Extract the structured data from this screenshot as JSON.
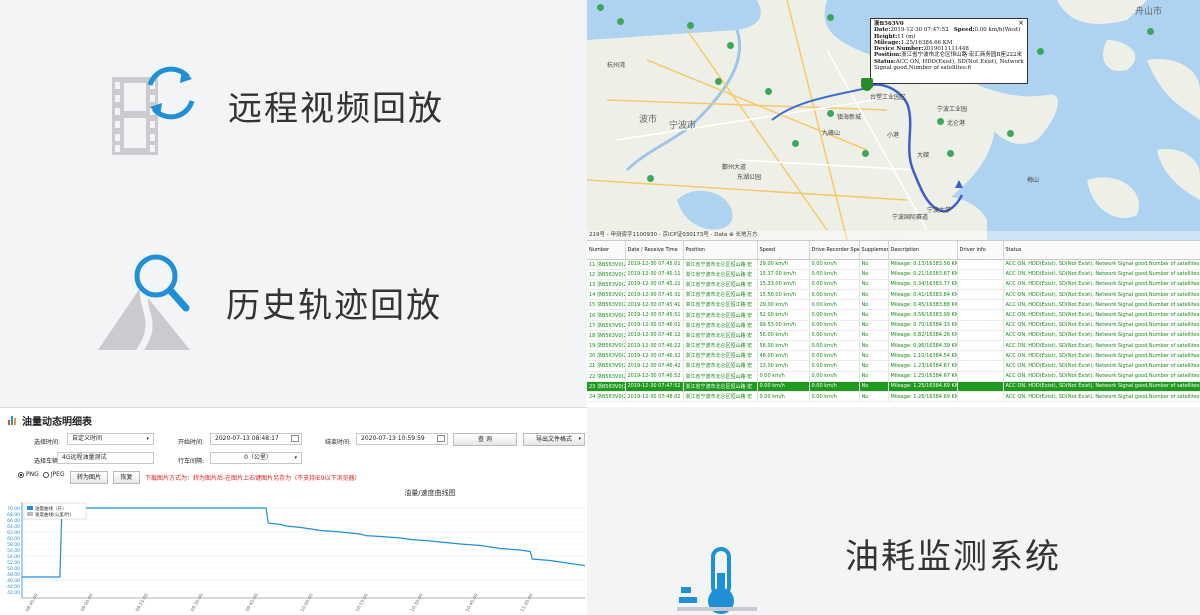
{
  "features": {
    "video": {
      "label": "远程视频回放",
      "icon": "film-sync-icon"
    },
    "track": {
      "label": "历史轨迹回放",
      "icon": "mountain-search-icon"
    },
    "fuel": {
      "label": "油耗监测系统",
      "icon": "thermometer-icon"
    }
  },
  "map": {
    "popup": {
      "plate": "浙B563V0",
      "date_label": "Date:",
      "date": "2019-12-30 07:47:52",
      "speed_label": "Speed:",
      "speed": "0.00 km/h(West)",
      "height_label": "Height:",
      "height": "11 (m)",
      "mileage_label": "Mileage:",
      "mileage": "1.25/16384.66 KM",
      "device_label": "Device Number:",
      "device": "2019011111448",
      "position_label": "Position:",
      "position": "浙江省宁波市北仑区恒山路·宏汇商务园B座222米",
      "status_label": "Status:",
      "status": "ACC ON, HDD(Exist), SD(Not Exist), Network Signal good,Number of satellites:6"
    },
    "cities": [
      "舟山市",
      "宁波市",
      "波市"
    ],
    "labels": [
      "台塑工业园区",
      "宁波工业园",
      "宁波大学",
      "东湖公园",
      "杭州湾",
      "宁波国际赛道",
      "九峰山",
      "镇海新城",
      "鄞州大道",
      "北仑港",
      "梅山",
      "大碶",
      "小港"
    ],
    "footer": "219号 - 甲测资字1100930 - 京ICP证030173号 - Data ⊕ 长地万方"
  },
  "table": {
    "headers": [
      "Number",
      "Date / Receive Time",
      "Position",
      "Speed",
      "Drive Recorder Speed",
      "Supplement",
      "Description",
      "Driver info",
      "Status"
    ],
    "selected_index": 12,
    "rows": [
      [
        "11 浙B563V0(2",
        "2019-12-30 07:45:01",
        "浙江省宁波市北仑区恒山路·宏",
        "29.00 km/h",
        "0.00 km/h",
        "No",
        "Mileage: 0.13/16383.56 KM",
        "",
        "ACC ON, HDD(Exist), SD(Not Exist), Network Signal good,Number of satellites:6"
      ],
      [
        "12 浙B563V0(2",
        "2019-12-30 07:45:11",
        "浙江省宁波市北仑区恒山路·宏",
        "15.37.00 km/h",
        "0.00 km/h",
        "No",
        "Mileage: 0.21/16383.67 KM",
        "",
        "ACC ON, HDD(Exist), SD(Not Exist), Network Signal good,Number of satellites:6"
      ],
      [
        "13 浙B563V0(2",
        "2019-12-30 07:45:21",
        "浙江省宁波市北仑区恒山路·宏",
        "15.33.00 km/h",
        "0.00 km/h",
        "No",
        "Mileage: 0.34/16383.77 KM",
        "",
        "ACC ON, HDD(Exist), SD(Not Exist), Network Signal good,Number of satellites:6"
      ],
      [
        "14 浙B563V0(2",
        "2019-12-30 07:45:31",
        "浙江省宁波市北仑区恒山路·宏",
        "15.50.00 km/h",
        "0.00 km/h",
        "No",
        "Mileage: 0.41/16383.84 KM",
        "",
        "ACC ON, HDD(Exist), SD(Not Exist), Network Signal good,Number of satellites:6"
      ],
      [
        "15 浙B563V0(2",
        "2019-12-30 07:45:41",
        "浙江省宁波市北仑区恒江路·宏",
        "29.00 km/h",
        "0.00 km/h",
        "No",
        "Mileage: 0.45/16383.88 KM",
        "",
        "ACC ON, HDD(Exist), SD(Not Exist), Network Signal good,Number of satellites:6"
      ],
      [
        "16 浙B563V0(2",
        "2019-12-30 07:45:51",
        "浙江省宁波市北仑区恒山路·宏",
        "52.00 km/h",
        "0.00 km/h",
        "No",
        "Mileage: 0.56/16383.99 KM",
        "",
        "ACC ON, HDD(Exist), SD(Not Exist), Network Signal good,Number of satellites:6"
      ],
      [
        "17 浙B563V0(2",
        "2019-12-30 07:46:01",
        "浙江省宁波市北仑区恒山路·宏",
        "99.53.00 km/h",
        "0.00 km/h",
        "No",
        "Mileage: 0.70/16384.13 KM",
        "",
        "ACC ON, HDD(Exist), SD(Not Exist), Network Signal good,Number of satellites:6"
      ],
      [
        "18 浙B563V0(2",
        "2019-12-30 07:46:12",
        "浙江省宁波市北仑区恒山路·宏",
        "56.00 km/h",
        "0.00 km/h",
        "No",
        "Mileage: 0.82/16384.26 KM",
        "",
        "ACC ON, HDD(Exist), SD(Not Exist), Network Signal good,Number of satellites:6"
      ],
      [
        "19 浙B563V0(2",
        "2019-12-30 07:46:22",
        "浙江省宁波市北仑区恒山路·宏",
        "56.00 km/h",
        "0.00 km/h",
        "No",
        "Mileage: 0.96/16384.39 KM",
        "",
        "ACC ON, HDD(Exist), SD(Not Exist), Network Signal good,Number of satellites:6"
      ],
      [
        "20 浙B563V0(2",
        "2019-12-30 07:46:32",
        "浙江省宁波市北仑区恒山路·宏",
        "48.00 km/h",
        "0.00 km/h",
        "No",
        "Mileage: 1.10/16384.54 KM",
        "",
        "ACC ON, HDD(Exist), SD(Not Exist), Network Signal good,Number of satellites:6"
      ],
      [
        "21 浙B563V0(2",
        "2019-12-30 07:46:42",
        "浙江省宁波市北仑区恒山路·宏",
        "13.00 km/h",
        "0.00 km/h",
        "No",
        "Mileage: 1.23/16384.67 KM",
        "",
        "ACC ON, HDD(Exist), SD(Not Exist), Network Signal good,Number of satellites:6"
      ],
      [
        "22 浙B563V0(2",
        "2019-12-30 07:46:52",
        "浙江省宁波市北仑区恒山路·宏",
        "0.00 km/h",
        "0.00 km/h",
        "No",
        "Mileage: 1.25/16384.67 KM",
        "",
        "ACC ON, HDD(Exist), SD(Not Exist), Network Signal good,Number of satellites:6"
      ],
      [
        "23 浙B563V0(2",
        "2019-12-30 07:47:52",
        "浙江省宁波市北仑区恒山路·宏",
        "0.00 km/h",
        "0.00 km/h",
        "No",
        "Mileage: 1.25/16384.69 KM",
        "",
        "ACC ON, HDD(Exist), SD(Not Exist), Network Signal good,Number of satellites:6"
      ],
      [
        "24 浙B563V0(2",
        "2019-12-30 07:48:02",
        "浙江省宁波市北仑区恒山路·宏",
        "0.00 km/h",
        "0.00 km/h",
        "No",
        "Mileage: 1.26/16384.69 KM",
        "",
        "ACC ON, HDD(Exist), SD(Not Exist), Network Signal good,Number of satellites:6"
      ]
    ]
  },
  "fuel": {
    "title": "油量动态明细表",
    "select_time_label": "选择时间:",
    "select_time_value": "自定义时间",
    "start_label": "开始时间:",
    "start_value": "2020-07-13 08:48:17",
    "end_label": "结束时间:",
    "end_value": "2020-07-13 10:59:59",
    "query_btn": "查 询",
    "export_btn": "导出文件格式",
    "vehicle_label": "选择车辆:",
    "vehicle_value": "4G远程油量测试",
    "gap_label": "行车间隔:",
    "gap_value": "0（公里）",
    "radio_png": "PNG",
    "radio_jpeg": "JPEG",
    "to_image_btn": "转为图片",
    "reset_btn": "恢复",
    "hint": "下载图片方式为：转为图片后-在图片上右键图片另存为（不支持IE9以下浏览器）"
  },
  "chart_data": {
    "type": "line",
    "title": "油量/速度曲线图",
    "series": [
      {
        "name": "油量曲线（升）",
        "color": "#1f8fd6",
        "points": [
          [
            0,
            47
          ],
          [
            38,
            47
          ],
          [
            40,
            70
          ],
          [
            245,
            70
          ],
          [
            247,
            65
          ],
          [
            260,
            64.5
          ],
          [
            265,
            64
          ],
          [
            280,
            63.5
          ],
          [
            290,
            63
          ],
          [
            300,
            62.5
          ],
          [
            320,
            62
          ],
          [
            340,
            61.3
          ],
          [
            345,
            60.8
          ],
          [
            360,
            60.5
          ],
          [
            380,
            60
          ],
          [
            390,
            59.5
          ],
          [
            410,
            59
          ],
          [
            425,
            58.5
          ],
          [
            440,
            58
          ],
          [
            460,
            57.5
          ],
          [
            480,
            56.5
          ],
          [
            500,
            56
          ],
          [
            510,
            55.5
          ],
          [
            512,
            53
          ],
          [
            530,
            52.5
          ],
          [
            550,
            51.5
          ],
          [
            565,
            50.8
          ]
        ]
      },
      {
        "name": "速度曲线(公里/时)",
        "color": "#bbbbbb",
        "points": []
      }
    ],
    "ylim": [
      40,
      72
    ],
    "y_ticks": [
      "70.00",
      "68.00",
      "66.00",
      "64.00",
      "62.00",
      "60.00",
      "58.00",
      "56.00",
      "54.00",
      "52.00",
      "50.00",
      "48.00",
      "46.00",
      "44.00",
      "42.00"
    ],
    "x_ticks": [
      "08:45:00",
      "09:00:00",
      "09:15:00",
      "09:30:00",
      "09:45:00",
      "10:00:00",
      "10:15:00",
      "10:30:00",
      "10:45:00",
      "11:00:00"
    ],
    "grid": true,
    "legend": "top-left"
  }
}
